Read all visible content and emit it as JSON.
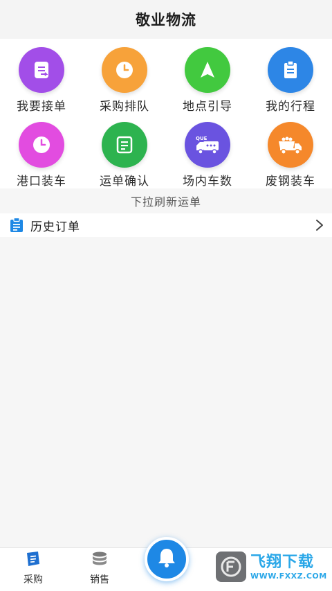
{
  "header": {
    "title": "敬业物流"
  },
  "menu": {
    "items": [
      {
        "label": "我要接单",
        "icon": "order-accept-icon",
        "color": "#a24ee8"
      },
      {
        "label": "采购排队",
        "icon": "clock-icon",
        "color": "#f7a23a"
      },
      {
        "label": "地点引导",
        "icon": "navigation-arrow-icon",
        "color": "#42c93f"
      },
      {
        "label": "我的行程",
        "icon": "clipboard-icon",
        "color": "#2d86e6"
      },
      {
        "label": "港口装车",
        "icon": "clock-icon",
        "color": "#e24ce0"
      },
      {
        "label": "运单确认",
        "icon": "waybill-icon",
        "color": "#2db34f"
      },
      {
        "label": "场内车数",
        "icon": "queue-truck-icon",
        "color": "#6a53e0"
      },
      {
        "label": "废钢装车",
        "icon": "dump-truck-icon",
        "color": "#f5882b"
      }
    ]
  },
  "pull_tip": "下拉刷新运单",
  "history": {
    "label": "历史订单"
  },
  "tabbar": {
    "tabs": [
      {
        "label": "采购",
        "icon": "purchase-icon"
      },
      {
        "label": "销售",
        "icon": "sales-stack-icon"
      }
    ],
    "center_icon": "bell-icon"
  },
  "queue_icon_text": "QUE",
  "watermark": {
    "title": "飞翔下载",
    "url": "WWW.FXXZ.COM"
  },
  "colors": {
    "accent": "#1e88e5",
    "watermark": "#2aa7e8"
  }
}
